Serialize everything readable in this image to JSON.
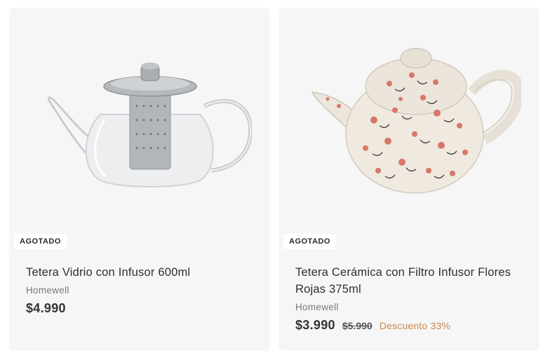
{
  "products": [
    {
      "badge": "AGOTADO",
      "title": "Tetera Vidrio con Infusor 600ml",
      "brand": "Homewell",
      "price": "$4.990",
      "image_icon": "glass-teapot-image"
    },
    {
      "badge": "AGOTADO",
      "title": "Tetera Cerámica con Filtro Infusor Flores Rojas 375ml",
      "brand": "Homewell",
      "price": "$3.990",
      "old_price": "$5.990",
      "discount": "Descuento 33%",
      "image_icon": "ceramic-floral-teapot-image"
    }
  ],
  "colors": {
    "card_bg": "#f6f6f6",
    "discount": "#c9894a",
    "price": "#333333"
  }
}
